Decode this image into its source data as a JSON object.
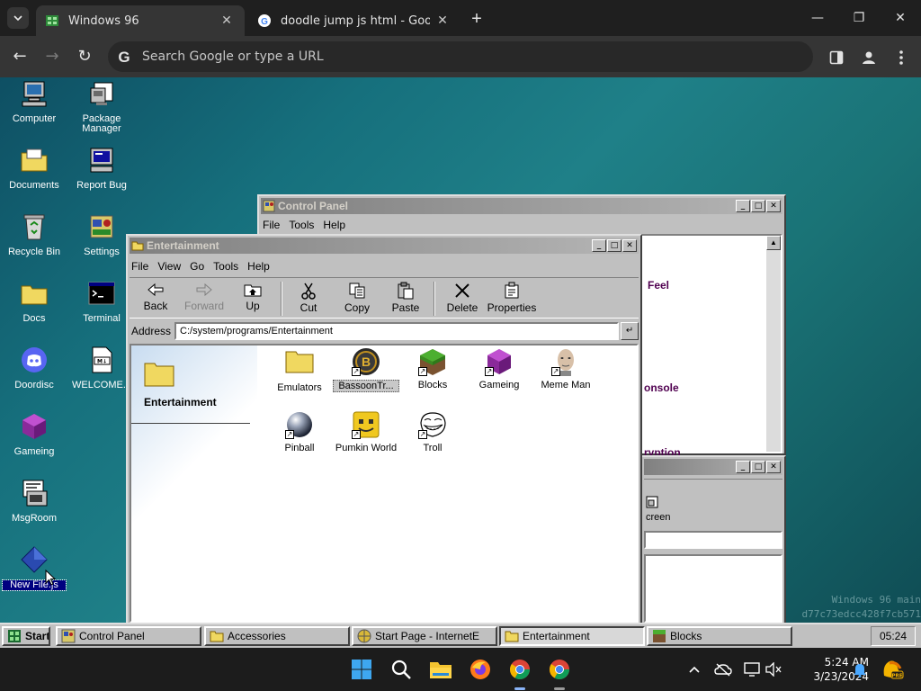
{
  "browser": {
    "tabs": [
      {
        "title": "Windows 96"
      },
      {
        "title": "doodle jump js html - Google S"
      }
    ],
    "omnibox_placeholder": "Search Google or type a URL"
  },
  "desktop": {
    "icons": [
      {
        "label": "Computer"
      },
      {
        "label": "Package Manager"
      },
      {
        "label": "Documents"
      },
      {
        "label": "Report Bug"
      },
      {
        "label": "Recycle Bin"
      },
      {
        "label": "Settings"
      },
      {
        "label": "Docs"
      },
      {
        "label": "Terminal"
      },
      {
        "label": "Doordisc"
      },
      {
        "label": "WELCOME..."
      },
      {
        "label": "Gameing"
      },
      {
        "label": "MsgRoom"
      },
      {
        "label": "New File.js"
      }
    ],
    "watermark_line1": "Windows 96 main",
    "watermark_line2": "d77c73edcc428f7cb571"
  },
  "control_panel": {
    "title": "Control Panel",
    "menu": [
      "File",
      "Tools",
      "Help"
    ],
    "items": [
      "Feel",
      "onsole",
      "ryption"
    ]
  },
  "bg_window": {
    "label": "creen"
  },
  "explorer": {
    "title": "Entertainment",
    "menu": [
      "File",
      "View",
      "Go",
      "Tools",
      "Help"
    ],
    "toolbar": [
      "Back",
      "Forward",
      "Up",
      "Cut",
      "Copy",
      "Paste",
      "Delete",
      "Properties"
    ],
    "address_label": "Address",
    "address": "C:/system/programs/Entertainment",
    "side_title": "Entertainment",
    "files": [
      {
        "label": "Emulators"
      },
      {
        "label": "BassoonTr..."
      },
      {
        "label": "Blocks"
      },
      {
        "label": "Gameing"
      },
      {
        "label": "Meme Man"
      },
      {
        "label": "Pinball"
      },
      {
        "label": "Pumkin World"
      },
      {
        "label": "Troll"
      }
    ]
  },
  "w96_taskbar": {
    "start": "Start",
    "items": [
      "Control Panel",
      "Accessories",
      "Start Page - InternetE",
      "Entertainment",
      "Blocks"
    ],
    "clock": "05:24"
  },
  "win11": {
    "time": "5:24 AM",
    "date": "3/23/2024"
  },
  "colors": {
    "desktop_teal": "#1a7376",
    "win96_face": "#c0c0c0",
    "win96_title_inactive": "#808080"
  }
}
